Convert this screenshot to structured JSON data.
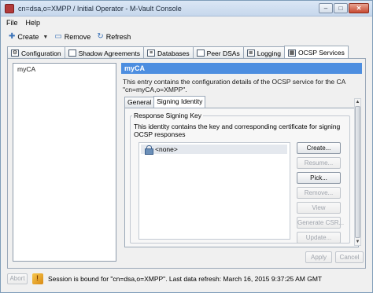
{
  "window": {
    "title": "cn=dsa,o=XMPP / Initial Operator - M-Vault Console",
    "controls": {
      "minimize": "–",
      "maximize": "□",
      "close": "✕"
    }
  },
  "menu": [
    "File",
    "Help"
  ],
  "toolbar": {
    "create_label": "Create",
    "remove_label": "Remove",
    "refresh_label": "Refresh"
  },
  "tabs": [
    {
      "label": "Configuration",
      "icon": "gear-icon"
    },
    {
      "label": "Shadow Agreements",
      "icon": "document-icon"
    },
    {
      "label": "Databases",
      "icon": "database-icon"
    },
    {
      "label": "Peer DSAs",
      "icon": "monitor-icon"
    },
    {
      "label": "Logging",
      "icon": "log-icon"
    },
    {
      "label": "OCSP Services",
      "icon": "ocsp-icon",
      "active": true
    }
  ],
  "left_list": {
    "items": [
      "myCA"
    ]
  },
  "detail": {
    "header": "myCA",
    "description": "This entry contains the configuration details of the OCSP service for the CA \"cn=myCA,o=XMPP\".",
    "subtabs": [
      "General",
      "Signing Identity"
    ],
    "group_title": "Response Signing Key",
    "group_description": "This identity contains the key and corresponding certificate for signing OCSP responses",
    "identity_row": "<none>",
    "buttons": {
      "create": "Create...",
      "resume": "Resume...",
      "pick": "Pick...",
      "remove": "Remove...",
      "view": "View",
      "generate_csr": "Generate CSR...",
      "update": "Update..."
    }
  },
  "footer": {
    "apply": "Apply",
    "cancel": "Cancel"
  },
  "status": {
    "abort": "Abort",
    "text": "Session is bound for \"cn=dsa,o=XMPP\". Last data refresh: March 16, 2015 9:37:25 AM GMT"
  },
  "colors": {
    "accent": "#4d8ee0",
    "disabled_text": "#a0a5ad"
  }
}
